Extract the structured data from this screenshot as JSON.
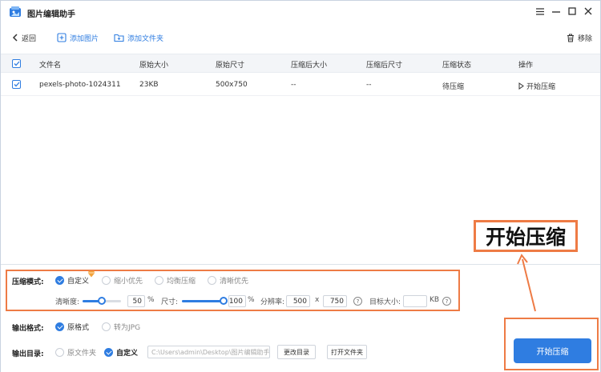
{
  "app": {
    "title": "图片编辑助手"
  },
  "toolbar": {
    "back_label": "返回",
    "add_image_label": "添加图片",
    "add_folder_label": "添加文件夹",
    "remove_label": "移除"
  },
  "table": {
    "headers": [
      "文件名",
      "原始大小",
      "原始尺寸",
      "压缩后大小",
      "压缩后尺寸",
      "压缩状态",
      "操作"
    ],
    "rows": [
      {
        "name": "pexels-photo-1024311",
        "orig_size": "23KB",
        "orig_dim": "500x750",
        "comp_size": "--",
        "comp_dim": "--",
        "status": "待压缩",
        "action": "开始压缩"
      }
    ]
  },
  "settings": {
    "mode_label": "压缩模式:",
    "modes": [
      {
        "label": "自定义",
        "selected": true
      },
      {
        "label": "缩小优先",
        "selected": false
      },
      {
        "label": "均衡压缩",
        "selected": false
      },
      {
        "label": "清晰优先",
        "selected": false
      }
    ],
    "clarity_label": "清晰度:",
    "clarity_value": "50",
    "clarity_fraction": 0.5,
    "percent": "%",
    "size_label": "尺寸:",
    "size_value": "100",
    "size_fraction": 1.0,
    "resolution_label": "分辨率:",
    "res_width": "500",
    "res_x": "x",
    "res_height": "750",
    "target_label": "目标大小:",
    "target_value": "",
    "target_unit": "KB",
    "help_glyph": "?",
    "format_label": "输出格式:",
    "formats": [
      {
        "label": "原格式",
        "selected": true
      },
      {
        "label": "转为JPG",
        "selected": false
      }
    ],
    "output_label": "输出目录:",
    "outputs": [
      {
        "label": "原文件夹",
        "selected": false
      },
      {
        "label": "自定义",
        "selected": true
      }
    ],
    "output_path": "C:\\Users\\admin\\Desktop\\图片编辑助手",
    "change_dir_label": "更改目录",
    "open_folder_label": "打开文件夹",
    "start_label": "开始压缩"
  },
  "annotation": {
    "callout_text": "开始压缩"
  },
  "colors": {
    "accent": "#2f7de1",
    "highlight": "#ee7b45"
  }
}
